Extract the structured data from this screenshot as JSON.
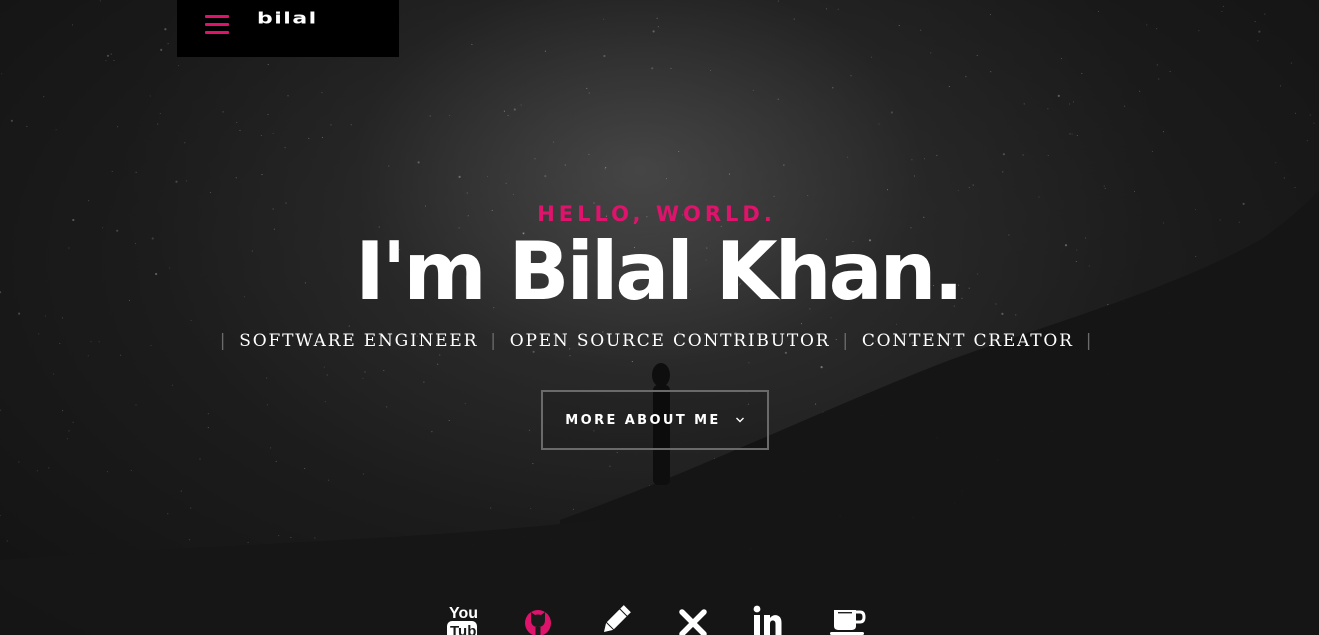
{
  "header": {
    "logo_text": "bilal",
    "menu_icon": "hamburger-icon",
    "accent_color": "#e0136c"
  },
  "intro": {
    "pretitle": "HELLO, WORLD.",
    "title": "I'm Bilal Khan.",
    "roles": [
      "SOFTWARE ENGINEER",
      "OPEN SOURCE CONTRIBUTOR",
      "CONTENT CREATOR"
    ],
    "separator": "|",
    "more_button_label": "MORE ABOUT ME",
    "more_button_icon": "chevron-down-icon"
  },
  "social": {
    "items": [
      {
        "name": "youtube",
        "icon": "youtube-icon",
        "text": "You Tube",
        "color": "#ffffff"
      },
      {
        "name": "github",
        "icon": "github-icon",
        "color": "#e0136c"
      },
      {
        "name": "blog",
        "icon": "pencil-icon",
        "color": "#ffffff"
      },
      {
        "name": "x",
        "icon": "x-icon",
        "color": "#ffffff"
      },
      {
        "name": "linkedin",
        "icon": "linkedin-icon",
        "text": "in",
        "color": "#ffffff"
      },
      {
        "name": "coffee",
        "icon": "coffee-cup-icon",
        "color": "#ffffff"
      }
    ]
  }
}
